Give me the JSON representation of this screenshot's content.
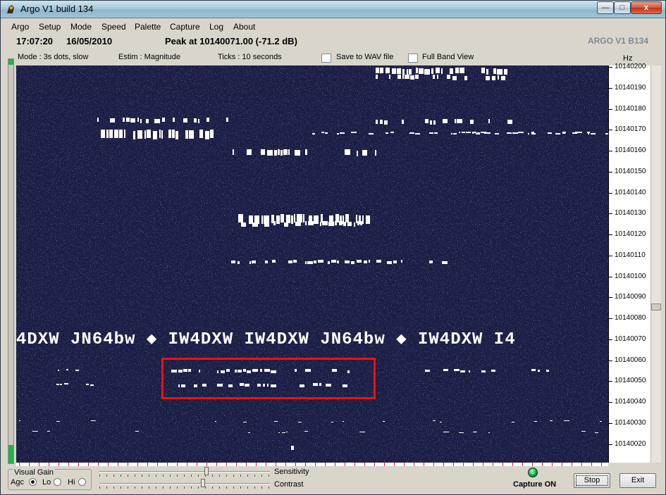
{
  "window": {
    "title": "Argo V1 build 134",
    "min_glyph": "—",
    "max_glyph": "□",
    "close_glyph": "x"
  },
  "menu": [
    "Argo",
    "Setup",
    "Mode",
    "Speed",
    "Palette",
    "Capture",
    "Log",
    "About"
  ],
  "status": {
    "time": "17:07:20",
    "date": "16/05/2010",
    "peak": "Peak at 10140071.00 (-71.2 dB)",
    "brand": "ARGO V1 B134"
  },
  "info": {
    "mode": "Mode : 3s dots, slow",
    "estim": "Estim : Magnitude",
    "ticks": "Ticks   : 10 seconds",
    "save_wav": "Save to WAV file",
    "full_band": "Full Band View",
    "hz": "Hz"
  },
  "scale_labels": [
    "10140200",
    "10140190",
    "10140180",
    "10140170",
    "10140160",
    "10140150",
    "10140140",
    "10140130",
    "10140120",
    "10140110",
    "10140100",
    "10140090",
    "10140080",
    "10140070",
    "10140060",
    "10140050",
    "10140040",
    "10140030",
    "10140020"
  ],
  "spectrogram_text": "4DXW  JN64bw  ◆  IW4DXW  IW4DXW  JN64bw  ◆  IW4DXW  I4",
  "bottom": {
    "visual_gain": "Visual Gain",
    "agc": "Agc",
    "lo": "Lo",
    "hi": "Hi",
    "sensitivity": "Sensitivity",
    "contrast": "Contrast",
    "capture_led": "C",
    "capture": "Capture ON",
    "stop": "Stop",
    "exit": "Exit"
  },
  "colors": {
    "waterfall_bg": "#1a1d44",
    "signal": "#ffffff",
    "highlight": "#ee1111",
    "led": "#22b14c"
  }
}
